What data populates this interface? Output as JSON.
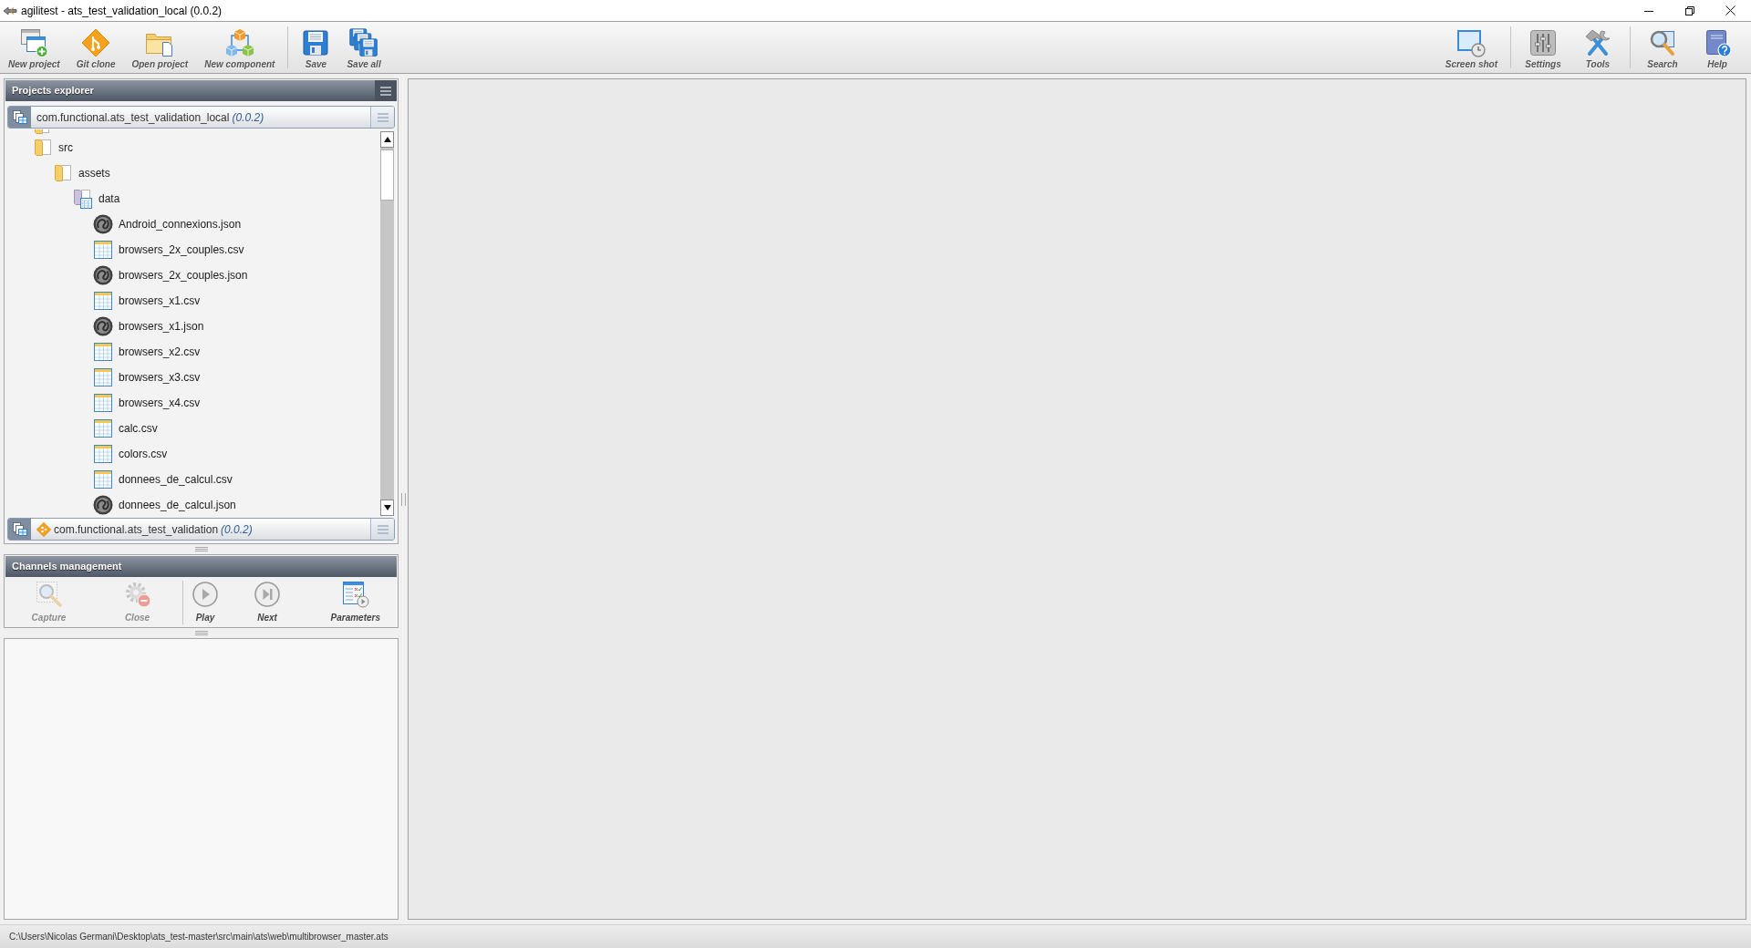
{
  "window": {
    "title": "agilitest - ats_test_validation_local (0.0.2)"
  },
  "toolbar": {
    "left": [
      {
        "items": [
          {
            "label": "New project"
          },
          {
            "label": "Git clone"
          },
          {
            "label": "Open project"
          },
          {
            "label": "New component"
          }
        ]
      },
      {
        "items": [
          {
            "label": "Save"
          },
          {
            "label": "Save all"
          }
        ]
      }
    ],
    "right": [
      {
        "items": [
          {
            "label": "Screen shot"
          }
        ]
      },
      {
        "items": [
          {
            "label": "Settings"
          },
          {
            "label": "Tools"
          }
        ]
      },
      {
        "items": [
          {
            "label": "Search"
          },
          {
            "label": "Help"
          }
        ]
      }
    ]
  },
  "projects_explorer": {
    "title": "Projects explorer",
    "projects": [
      {
        "name": "com.functional.ats_test_validation_local",
        "version": "(0.0.2)",
        "git": false,
        "tree": [
          {
            "name": "src",
            "kind": "folder",
            "children": [
              {
                "name": "assets",
                "kind": "folder",
                "children": [
                  {
                    "name": "data",
                    "kind": "data_folder",
                    "children": [
                      {
                        "name": "Android_connexions.json",
                        "kind": "json"
                      },
                      {
                        "name": "browsers_2x_couples.csv",
                        "kind": "csv"
                      },
                      {
                        "name": "browsers_2x_couples.json",
                        "kind": "json"
                      },
                      {
                        "name": "browsers_x1.csv",
                        "kind": "csv"
                      },
                      {
                        "name": "browsers_x1.json",
                        "kind": "json"
                      },
                      {
                        "name": "browsers_x2.csv",
                        "kind": "csv"
                      },
                      {
                        "name": "browsers_x3.csv",
                        "kind": "csv"
                      },
                      {
                        "name": "browsers_x4.csv",
                        "kind": "csv"
                      },
                      {
                        "name": "calc.csv",
                        "kind": "csv"
                      },
                      {
                        "name": "colors.csv",
                        "kind": "csv"
                      },
                      {
                        "name": "donnees_de_calcul.csv",
                        "kind": "csv"
                      },
                      {
                        "name": "donnees_de_calcul.json",
                        "kind": "json"
                      }
                    ]
                  }
                ]
              }
            ]
          }
        ]
      },
      {
        "name": "com.functional.ats_test_validation",
        "version": "(0.0.2)",
        "git": true
      }
    ]
  },
  "channels_management": {
    "title": "Channels management",
    "groups": [
      {
        "items": [
          {
            "label": "Capture",
            "disabled": true
          },
          {
            "label": "Close",
            "disabled": true
          }
        ]
      },
      {
        "items": [
          {
            "label": "Play",
            "disabled": false
          },
          {
            "label": "Next",
            "disabled": false
          },
          {
            "label": "Parameters",
            "disabled": false
          }
        ]
      }
    ]
  },
  "status_bar": {
    "path": "C:\\Users\\Nicolas Germani\\Desktop\\ats_test-master\\src\\main\\ats\\web\\multibrowser_master.ats"
  }
}
